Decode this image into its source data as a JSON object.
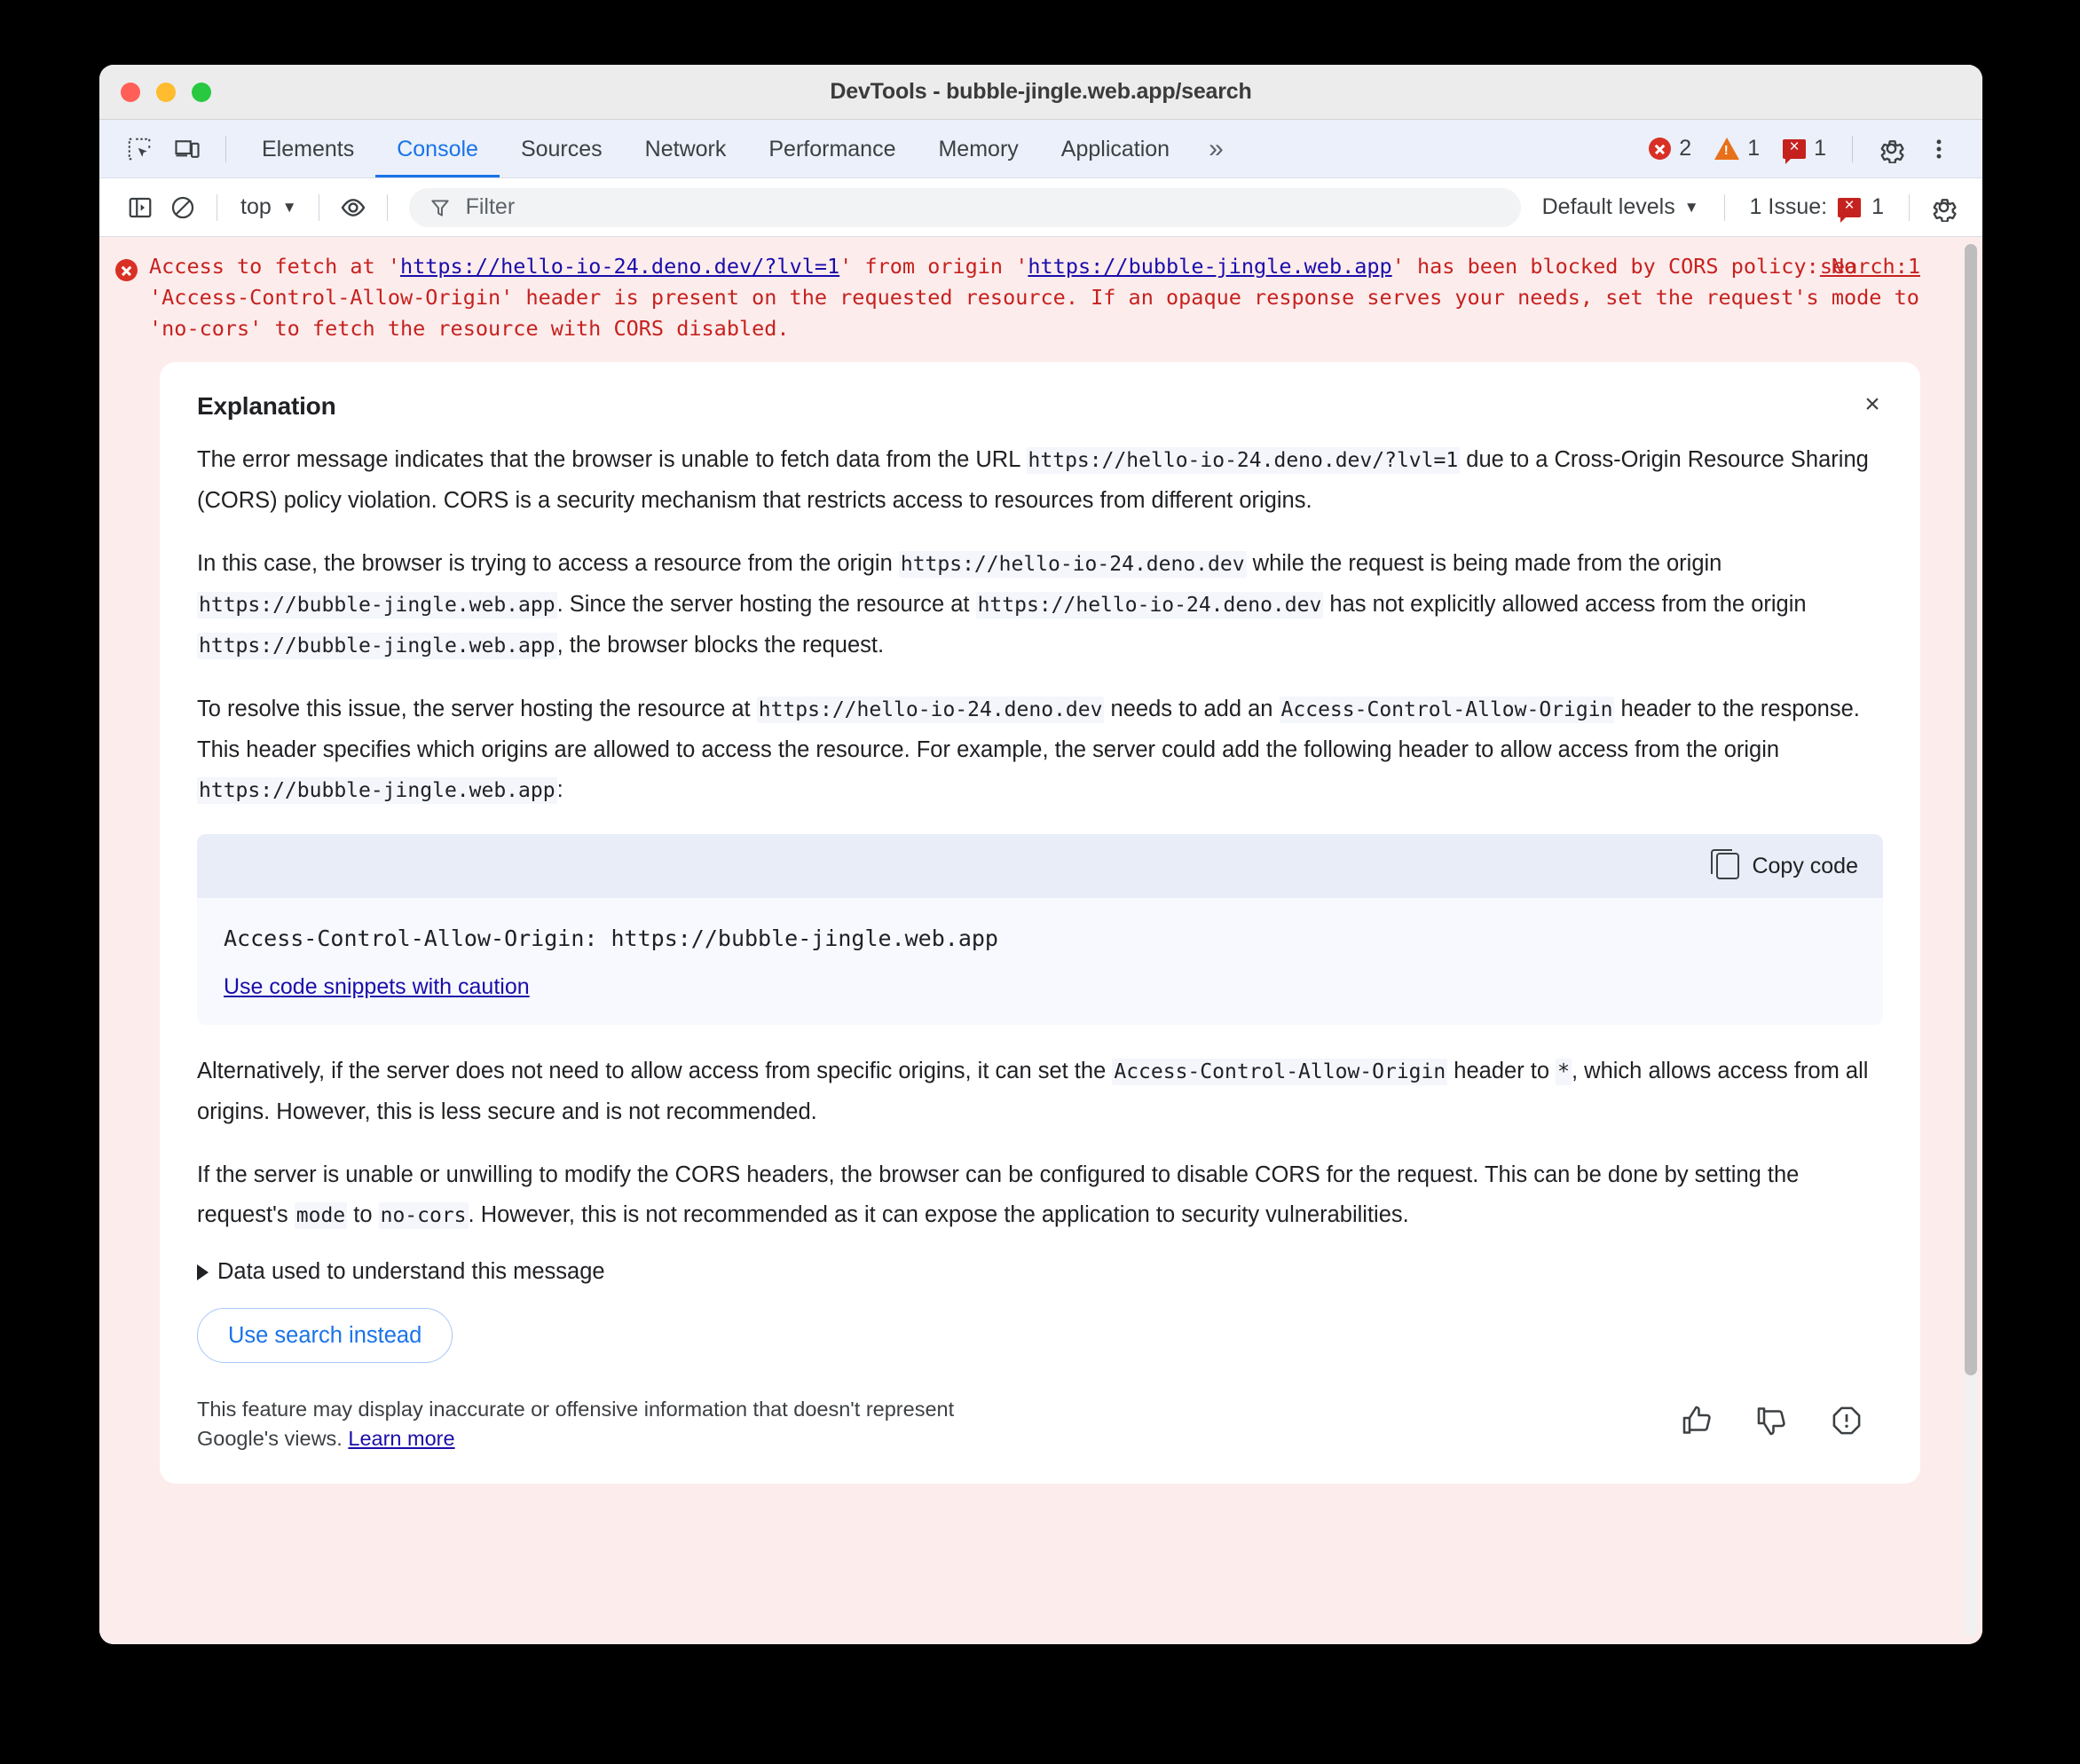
{
  "window": {
    "title": "DevTools - bubble-jingle.web.app/search",
    "traffic_lights": [
      "close",
      "minimize",
      "maximize"
    ]
  },
  "tabbar": {
    "inspect_icon": "inspect-element-icon",
    "device_icon": "device-toolbar-icon",
    "tabs": [
      {
        "label": "Elements",
        "active": false
      },
      {
        "label": "Console",
        "active": true
      },
      {
        "label": "Sources",
        "active": false
      },
      {
        "label": "Network",
        "active": false
      },
      {
        "label": "Performance",
        "active": false
      },
      {
        "label": "Memory",
        "active": false
      },
      {
        "label": "Application",
        "active": false
      }
    ],
    "more_tabs_label": "»",
    "counters": {
      "errors": "2",
      "warnings": "1",
      "issues": "1"
    },
    "settings_icon": "gear-icon",
    "more_options_icon": "kebab-menu-icon"
  },
  "console_toolbar": {
    "sidebar_icon": "show-console-sidebar-icon",
    "clear_icon": "clear-console-icon",
    "context": "top",
    "context_caret": "▼",
    "eye_icon": "live-expression-icon",
    "filter_placeholder": "Filter",
    "filter_value": "",
    "levels_label": "Default levels",
    "levels_caret": "▼",
    "issues_label": "1 Issue:",
    "issues_count": "1",
    "settings_icon": "console-settings-icon"
  },
  "console_message": {
    "severity": "error",
    "text_part1": "Access to fetch at '",
    "link1": "https://hello-io-24.deno.dev/?lvl=1",
    "text_part2": "' from origin '",
    "link2": "https://bubble-jingle.web.app",
    "text_part3": "' has been blocked by CORS policy: No 'Access-Control-Allow-Origin' header is present on the requested resource. If an opaque response serves your needs, set the request's mode to 'no-cors' to fetch the resource with CORS disabled.",
    "source_link": "search:1"
  },
  "explanation": {
    "title": "Explanation",
    "close_label": "×",
    "paragraph1": {
      "seg1": "The error message indicates that the browser is unable to fetch data from the URL ",
      "code1": "https://hello-io-24.deno.dev/?lvl=1",
      "seg2": " due to a Cross-Origin Resource Sharing (CORS) policy violation. CORS is a security mechanism that restricts access to resources from different origins."
    },
    "paragraph2": {
      "seg1": "In this case, the browser is trying to access a resource from the origin ",
      "code1": "https://hello-io-24.deno.dev",
      "seg2": " while the request is being made from the origin ",
      "code2": "https://bubble-jingle.web.app",
      "seg3": ". Since the server hosting the resource at ",
      "code3": "https://hello-io-24.deno.dev",
      "seg4": " has not explicitly allowed access from the origin ",
      "code4": "https://bubble-jingle.web.app",
      "seg5": ", the browser blocks the request."
    },
    "paragraph3": {
      "seg1": "To resolve this issue, the server hosting the resource at ",
      "code1": "https://hello-io-24.deno.dev",
      "seg2": " needs to add an ",
      "code2": "Access-Control-Allow-Origin",
      "seg3": " header to the response. This header specifies which origins are allowed to access the resource. For example, the server could add the following header to allow access from the origin ",
      "code3": "https://bubble-jingle.web.app",
      "seg4": ":"
    },
    "code_block": {
      "copy_label": "Copy code",
      "copy_icon": "copy-icon",
      "code": "Access-Control-Allow-Origin: https://bubble-jingle.web.app",
      "caution_link": "Use code snippets with caution"
    },
    "paragraph4": {
      "seg1": "Alternatively, if the server does not need to allow access from specific origins, it can set the ",
      "code1": "Access-Control-Allow-Origin",
      "seg2": " header to ",
      "code2": "*",
      "seg3": ", which allows access from all origins. However, this is less secure and is not recommended."
    },
    "paragraph5": {
      "seg1": "If the server is unable or unwilling to modify the CORS headers, the browser can be configured to disable CORS for the request. This can be done by setting the request's ",
      "code1": "mode",
      "seg2": " to ",
      "code2": "no-cors",
      "seg3": ". However, this is not recommended as it can expose the application to security vulnerabilities."
    },
    "disclosure_label": "Data used to understand this message",
    "disclosure_icon": "triangle-right-icon",
    "search_button": "Use search instead",
    "disclaimer": {
      "text": "This feature may display inaccurate or offensive information that doesn't represent Google's views. ",
      "link": "Learn more"
    },
    "feedback": {
      "thumb_up_icon": "thumb-up-icon",
      "thumb_down_icon": "thumb-down-icon",
      "report_icon": "report-issue-icon"
    }
  }
}
